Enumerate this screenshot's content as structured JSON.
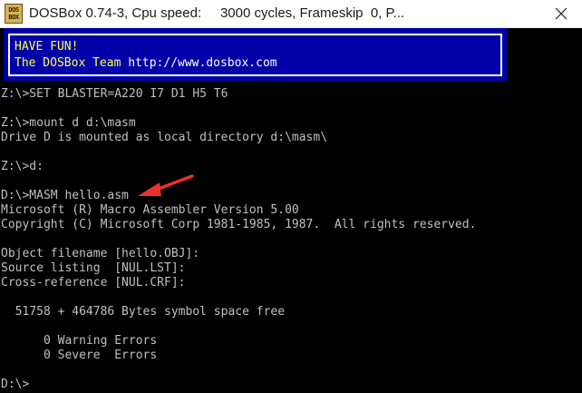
{
  "window": {
    "title": "DOSBox 0.74-3, Cpu speed:     3000 cycles, Frameskip  0, P...",
    "icon_line1": "DOS",
    "icon_line2": "BOX",
    "icon_name": "dosbox-app-icon",
    "close_icon_name": "close-icon"
  },
  "banner": {
    "line1": "HAVE FUN!",
    "line2_prefix": "The DOSBox Team ",
    "line2_url": "http://www.dosbox.com",
    "background": "#0000A8",
    "text_color": "#FFFF55"
  },
  "console": {
    "lines": [
      "Z:\\>SET BLASTER=A220 I7 D1 H5 T6",
      "",
      "Z:\\>mount d d:\\masm",
      "Drive D is mounted as local directory d:\\masm\\",
      "",
      "Z:\\>d:",
      "",
      "D:\\>MASM hello.asm",
      "Microsoft (R) Macro Assembler Version 5.00",
      "Copyright (C) Microsoft Corp 1981-1985, 1987.  All rights reserved.",
      "",
      "Object filename [hello.OBJ]:",
      "Source listing  [NUL.LST]:",
      "Cross-reference [NUL.CRF]:",
      "",
      "  51758 + 464786 Bytes symbol space free",
      "",
      "      0 Warning Errors",
      "      0 Severe  Errors",
      "",
      "D:\\>"
    ],
    "text_color": "#C0C0C0"
  },
  "annotation": {
    "icon_name": "red-arrow-annotation",
    "color": "#E8332A"
  }
}
